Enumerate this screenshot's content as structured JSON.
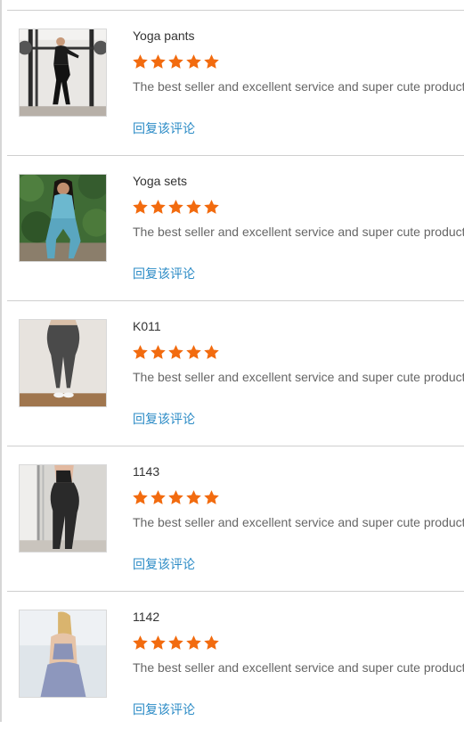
{
  "reviews": [
    {
      "title": "Yoga pants",
      "rating": 5,
      "comment": "The best seller and excellent service and super cute products",
      "reply_label": "回复该评论",
      "photo": "woman-gym-squat-rack-photo"
    },
    {
      "title": "Yoga sets",
      "rating": 5,
      "comment": "The best seller and excellent service and super cute products",
      "reply_label": "回复该评论",
      "photo": "woman-blue-yoga-set-photo"
    },
    {
      "title": "K011",
      "rating": 5,
      "comment": "The best seller and excellent service and super cute products",
      "reply_label": "回复该评论",
      "photo": "gray-leggings-back-photo"
    },
    {
      "title": "1143",
      "rating": 5,
      "comment": "The best seller and excellent service and super cute products",
      "reply_label": "回复该评论",
      "photo": "black-leggings-side-photo"
    },
    {
      "title": "1142",
      "rating": 5,
      "comment": "The best seller and excellent service and super cute products",
      "reply_label": "回复该评论",
      "photo": "lavender-yoga-set-back-photo"
    }
  ],
  "colors": {
    "star": "#f26b0f",
    "reply_link": "#2b8bc6",
    "divider": "#cfcfcf"
  }
}
